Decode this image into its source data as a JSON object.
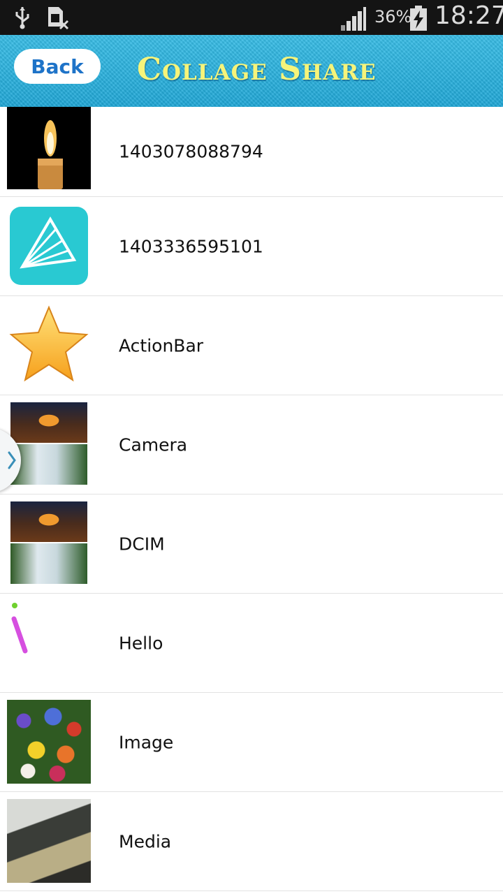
{
  "status_bar": {
    "battery_percent": "36%",
    "time": "18:27",
    "icons": [
      "usb-icon",
      "sim-card-icon",
      "signal-icon",
      "battery-charging-icon"
    ]
  },
  "header": {
    "back_label": "Back",
    "title": "Collage Share"
  },
  "folders": [
    {
      "name": "1403078088794",
      "thumb": "candle"
    },
    {
      "name": "1403336595101",
      "thumb": "app-logo"
    },
    {
      "name": "ActionBar",
      "thumb": "star"
    },
    {
      "name": "Camera",
      "thumb": "bridge-waterfall"
    },
    {
      "name": "DCIM",
      "thumb": "bridge-waterfall"
    },
    {
      "name": "Hello",
      "thumb": "pink-stroke"
    },
    {
      "name": "Image",
      "thumb": "flowers"
    },
    {
      "name": "Media",
      "thumb": "laptop-photo"
    }
  ],
  "colors": {
    "header": "#1fa7d6",
    "title": "#f6f47a",
    "back_text": "#1e73c8"
  }
}
